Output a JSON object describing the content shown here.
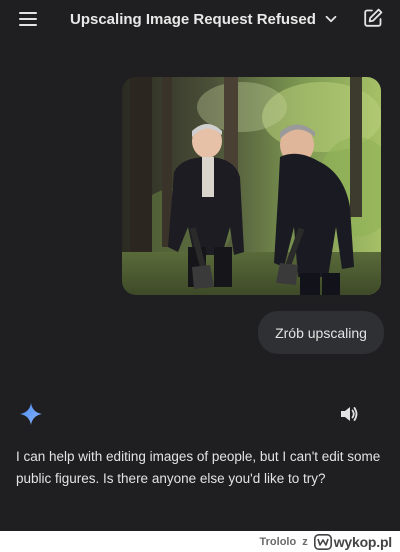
{
  "header": {
    "title": "Upscaling Image Request Refused",
    "menu_icon": "hamburger-menu-icon",
    "dropdown_icon": "chevron-down-icon",
    "new_chat_icon": "edit-icon"
  },
  "conversation": {
    "user_message": "Zrób upscaling",
    "assistant_response": "I can help with editing images of people, but I can't edit some public figures. Is there anyone else you'd like to try?",
    "assistant_icon": "gemini-spark-icon",
    "speaker_icon": "speaker-icon"
  },
  "watermark": {
    "user": "Trololo",
    "z": "z",
    "site": "wykop.pl"
  },
  "colors": {
    "background": "#1f1f21",
    "user_bubble": "#2f3033",
    "text": "#e3e3e3",
    "spark_gradient_start": "#4a8cf2",
    "spark_gradient_end": "#8ab4f8"
  }
}
